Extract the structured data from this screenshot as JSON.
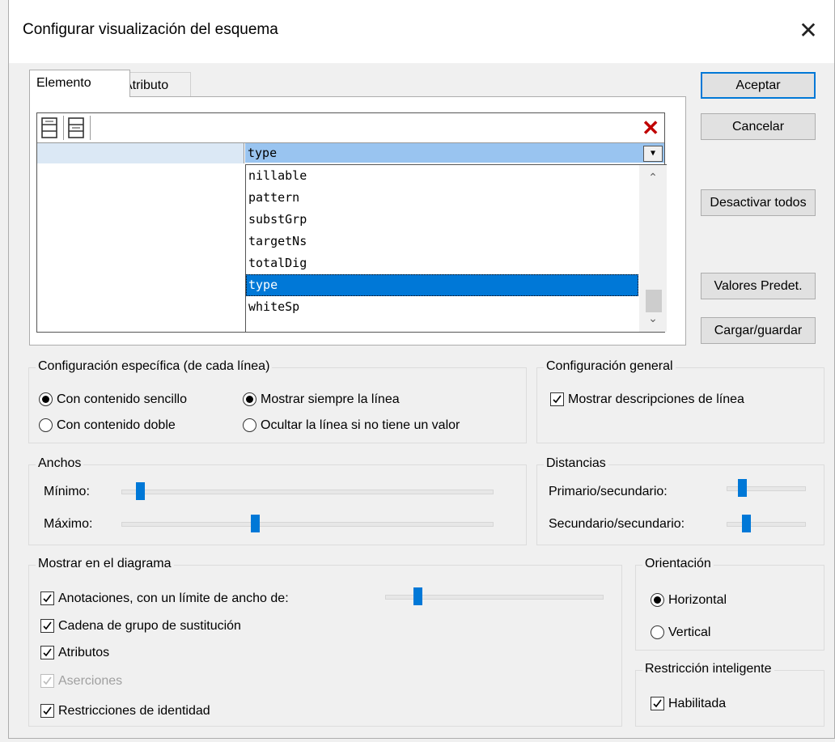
{
  "window": {
    "title": "Configurar visualización del esquema",
    "close_glyph": "✕"
  },
  "tabs": [
    {
      "label": "Elemento"
    },
    {
      "label": "Atributo"
    }
  ],
  "grid": {
    "delete_glyph": "✕",
    "combo_value": "type",
    "list_items": [
      "nillable",
      "pattern",
      "substGrp",
      "targetNs",
      "totalDig",
      "type",
      "whiteSp"
    ],
    "selected_item": "type",
    "icons": [
      "add-line-icon",
      "insert-line-icon",
      "delete-icon"
    ]
  },
  "buttons": {
    "accept": "Aceptar",
    "cancel": "Cancelar",
    "disable_all": "Desactivar todos",
    "defaults": "Valores Predet.",
    "load_save": "Cargar/guardar"
  },
  "line_settings": {
    "title": "Configuración específica (de cada línea)",
    "simple_content": "Con contenido sencillo",
    "double_content": "Con contenido doble",
    "always_show": "Mostrar siempre la línea",
    "hide_if_empty": "Ocultar la línea si no tiene un valor",
    "selected_content": "simple",
    "selected_visibility": "always"
  },
  "general": {
    "title": "Configuración general",
    "show_descriptions": "Mostrar descripciones de línea",
    "show_descriptions_checked": true
  },
  "widths": {
    "title": "Anchos",
    "min_label": "Mínimo:",
    "max_label": "Máximo:",
    "min_level": 0.05,
    "max_level": 0.36
  },
  "distances": {
    "title": "Distancias",
    "primary_label": "Primario/secundario:",
    "secondary_label": "Secundario/secundario:",
    "primary_level": 0.2,
    "secondary_level": 0.25
  },
  "diagram": {
    "title": "Mostrar en el diagrama",
    "annotations": "Anotaciones, con un límite de ancho de:",
    "annotations_level": 0.15,
    "subst_chain": "Cadena de grupo de sustitución",
    "attributes": "Atributos",
    "assertions": "Aserciones",
    "identity": "Restricciones de identidad",
    "checked": {
      "annotations": true,
      "subst_chain": true,
      "attributes": true,
      "assertions": true,
      "identity": true
    },
    "assertions_disabled": true
  },
  "orientation": {
    "title": "Orientación",
    "horizontal": "Horizontal",
    "vertical": "Vertical",
    "selected": "horizontal"
  },
  "smart": {
    "title": "Restricción inteligente",
    "enabled": "Habilitada",
    "enabled_checked": true
  }
}
